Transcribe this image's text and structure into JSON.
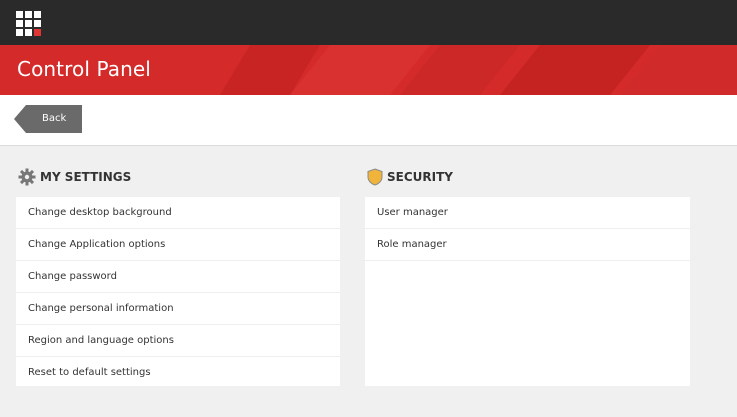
{
  "header": {
    "title": "Control Panel"
  },
  "toolbar": {
    "back_label": "Back"
  },
  "icons": {
    "apps": "apps-grid-icon",
    "settings": "gear-icon",
    "security": "shield-icon"
  },
  "colors": {
    "topbar": "#2a2a2a",
    "title_bar": "#d42a2a",
    "accent": "#e03535"
  },
  "my_settings": {
    "title": "MY SETTINGS",
    "items": [
      {
        "label": "Change desktop background"
      },
      {
        "label": "Change Application options"
      },
      {
        "label": "Change password"
      },
      {
        "label": "Change personal information"
      },
      {
        "label": "Region and language options"
      },
      {
        "label": "Reset to default settings"
      }
    ]
  },
  "security": {
    "title": "SECURITY",
    "items": [
      {
        "label": "User manager"
      },
      {
        "label": "Role manager"
      }
    ]
  }
}
